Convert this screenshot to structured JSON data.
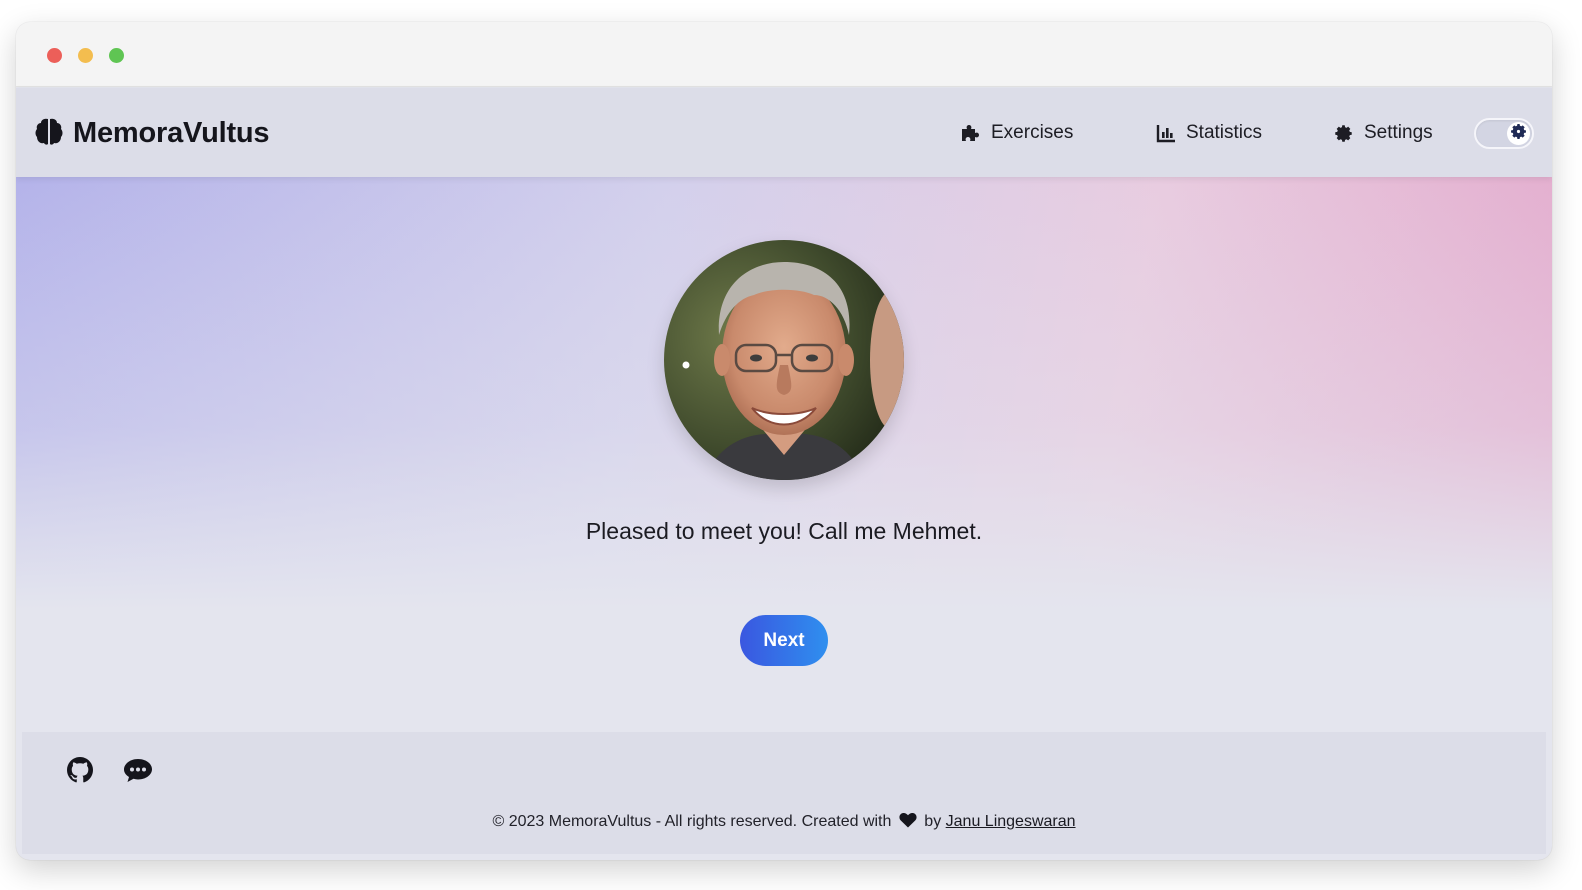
{
  "app": {
    "brand_name": "MemoraVultus",
    "brand_icon": "brain-icon"
  },
  "nav": {
    "items": [
      {
        "label": "Exercises",
        "icon": "puzzle-icon"
      },
      {
        "label": "Statistics",
        "icon": "chart-icon"
      },
      {
        "label": "Settings",
        "icon": "gear-icon"
      }
    ],
    "theme_toggle_icon": "gear-icon"
  },
  "main": {
    "avatar_alt": "portrait of a smiling older man with glasses",
    "greeting": "Pleased to meet you! Call me Mehmet.",
    "next_label": "Next"
  },
  "footer": {
    "icons": [
      "github-icon",
      "chat-icon"
    ],
    "copyright_prefix": "© 2023 MemoraVultus - All rights reserved. Created with",
    "copyright_by": "by",
    "author": "Janu Lingeswaran"
  },
  "colors": {
    "accent_start": "#3a57e0",
    "accent_end": "#2f8fef",
    "navbar_bg": "#dcdde8"
  }
}
